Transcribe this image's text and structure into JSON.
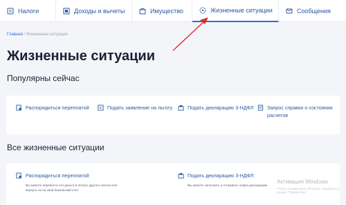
{
  "nav": {
    "items": [
      {
        "label": "Налоги",
        "icon": "tax-icon"
      },
      {
        "label": "Доходы и вычеты",
        "icon": "income-icon"
      },
      {
        "label": "Имущество",
        "icon": "property-icon"
      },
      {
        "label": "Жизненные ситуации",
        "icon": "life-situations-icon",
        "active": true
      },
      {
        "label": "Сообщения",
        "icon": "messages-icon"
      }
    ]
  },
  "breadcrumb": {
    "home": "Главная",
    "separator": "/",
    "current": "Жизненные ситуации"
  },
  "page": {
    "title": "Жизненные ситуации"
  },
  "popular": {
    "title": "Популярны сейчас",
    "items": [
      {
        "label": "Распорядиться переплатой",
        "icon": "overpayment-icon"
      },
      {
        "label": "Подать заявление на льготу",
        "icon": "application-icon"
      },
      {
        "label": "Подать декларацию 3-НДФЛ",
        "icon": "declaration-icon"
      },
      {
        "label": "Запрос справки о состоянии расчетов",
        "icon": "certificate-icon"
      }
    ]
  },
  "all": {
    "title": "Все жизненные ситуации",
    "items": [
      {
        "label": "Распорядиться переплатой",
        "desc": "Вы можете перевести эти деньги в оплату другого налога или вернуть их на свой банковский счет.",
        "icon": "overpayment-icon"
      },
      {
        "label": "Подать декларацию 3-НДФЛ",
        "desc": "Вы можете заполнить и отправить новую декларацию",
        "icon": "declaration-icon"
      }
    ]
  },
  "watermark": {
    "line1": "Активация Windows",
    "line2": "Чтобы активировать Windows, перейдите в раздел \"Параметры\"."
  },
  "colors": {
    "accent": "#2d6bd6",
    "link": "#2c5aa0",
    "annotation": "#d9302b"
  }
}
